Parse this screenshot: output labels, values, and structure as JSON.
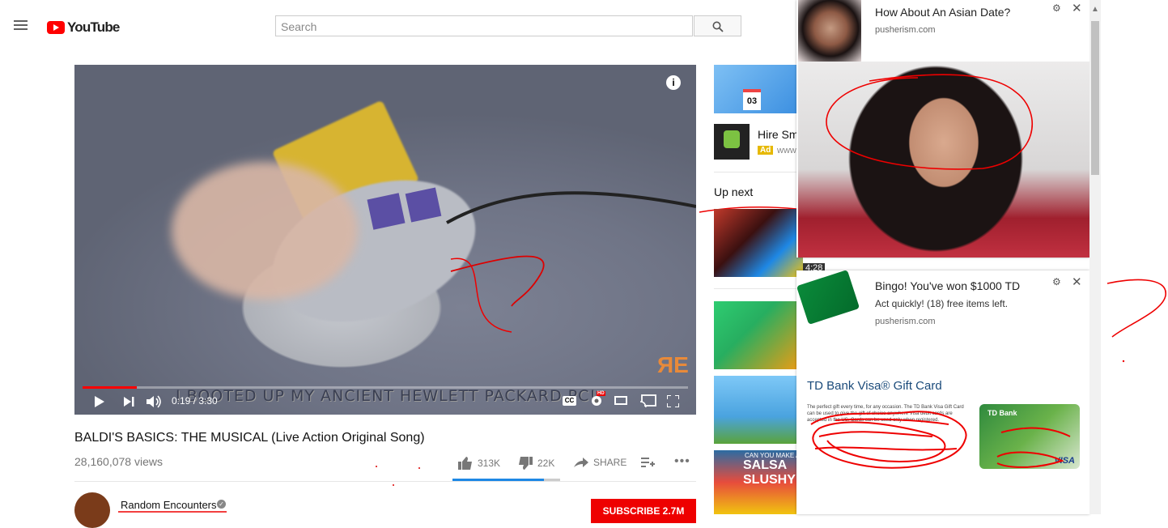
{
  "header": {
    "logo_text": "YouTube",
    "search_placeholder": "Search"
  },
  "player": {
    "caption": "I BOOTED UP MY ANCIENT HEWLETT PACKARD PC!",
    "current_time": "0:19",
    "duration": "3:30",
    "progress": 0.09,
    "watermark": "ЯE",
    "cc_label": "CC",
    "hd_label": "HD"
  },
  "video": {
    "title": "BALDI'S BASICS: THE MUSICAL (Live Action Original Song)",
    "views": "28,160,078 views",
    "likes": "313K",
    "dislikes": "22K",
    "share_label": "SHARE",
    "like_ratio": 0.85,
    "channel": "Random Encounters",
    "subscribe_label": "SUBSCRIBE 2.7M"
  },
  "sidebar": {
    "ad_calendar_day": "03",
    "ad_title": "Hire Sm",
    "ad_badge": "Ad",
    "ad_url": "www",
    "up_next_label": "Up next",
    "thumb1_duration": "4:28",
    "thumb4_top": "CAN YOU MAKE A",
    "thumb4_title": "SALSA SLUSHY"
  },
  "notifications": [
    {
      "title": "How About An Asian Date?",
      "source": "pusherism.com"
    },
    {
      "title": "Bingo! You've won $1000 TD",
      "message": "Act quickly! (18) free items left.",
      "source": "pusherism.com",
      "card_heading": "TD Bank Visa® Gift Card",
      "card_desc": "The perfect gift every time, for any occasion. The TD Bank Visa Gift Card can be used to give the gift of choice anywhere Visa debit cards are accepted in the US. Cards can be used only when registered.",
      "card_brand": "TD Bank",
      "card_network": "VISA"
    }
  ],
  "colors": {
    "brand_red": "#ff0000",
    "like_blue": "#1e88e5"
  }
}
